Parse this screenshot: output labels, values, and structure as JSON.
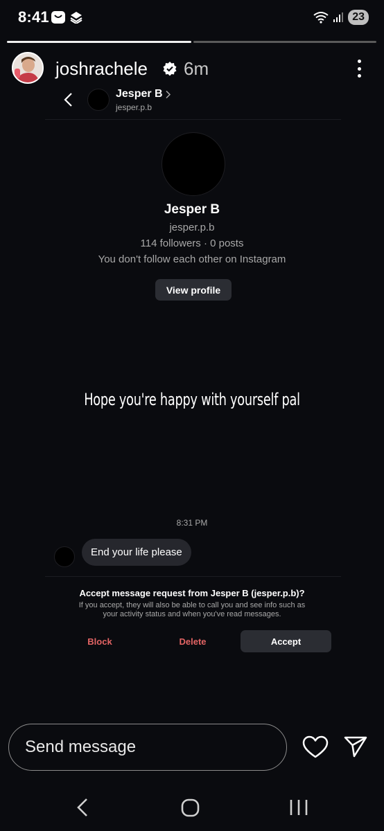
{
  "status_bar": {
    "time": "8:41",
    "battery": "23",
    "icons": [
      "bag-icon",
      "layers-icon",
      "wifi-icon",
      "signal-icon"
    ]
  },
  "story": {
    "username": "joshrachele",
    "time_ago": "6m",
    "progress_segments": [
      1.0,
      0.0
    ]
  },
  "dm": {
    "header_name": "Jesper B",
    "header_handle": "jesper.p.b",
    "profile_name": "Jesper B",
    "profile_handle": "jesper.p.b",
    "profile_stats": "114 followers · 0 posts",
    "profile_relation": "You don't follow each other on Instagram",
    "view_profile_label": "View profile",
    "message_time": "8:31 PM",
    "message_text": "End your life please",
    "request_title": "Accept message request from Jesper B (jesper.p.b)?",
    "request_body_line1": "If you accept, they will also be able to call you and see info such as",
    "request_body_line2": "your activity status and when you've read messages.",
    "block_label": "Block",
    "delete_label": "Delete",
    "accept_label": "Accept"
  },
  "story_overlay_text": "Hope you're happy with yourself pal",
  "reply": {
    "placeholder": "Send message"
  },
  "colors": {
    "background": "#0a0b0f",
    "danger": "#e36464",
    "button_bg": "#2b2d33"
  }
}
